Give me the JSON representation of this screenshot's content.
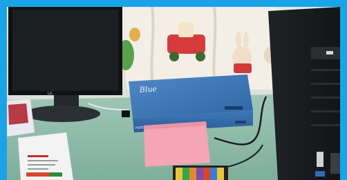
{
  "scene": {
    "monitor_brand": "LG",
    "device_brand": "Blue",
    "device_model": "PORTA-TYPE",
    "frame_color": "#1aa3e6"
  }
}
